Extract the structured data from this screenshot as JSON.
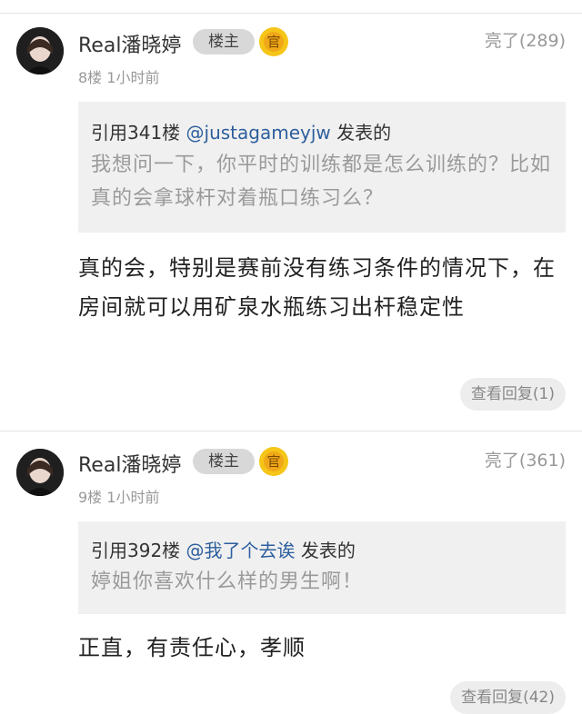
{
  "posts": [
    {
      "username": "Real潘晓婷",
      "badge_host": "楼主",
      "badge_official": "官",
      "likes": "亮了(289)",
      "floor_time": "8楼 1小时前",
      "quote": {
        "prefix": "引用341楼 ",
        "user": "@justagameyjw",
        "suffix": " 发表的",
        "text": "我想问一下，你平时的训练都是怎么训练的？比如真的会拿球杆对着瓶口练习么？"
      },
      "reply": "真的会，特别是赛前没有练习条件的情况下，在房间就可以用矿泉水瓶练习出杆稳定性",
      "view_replies": "查看回复(1)"
    },
    {
      "username": "Real潘晓婷",
      "badge_host": "楼主",
      "badge_official": "官",
      "likes": "亮了(361)",
      "floor_time": "9楼 1小时前",
      "quote": {
        "prefix": "引用392楼 ",
        "user": "@我了个去诶",
        "suffix": " 发表的",
        "text": "婷姐你喜欢什么样的男生啊！"
      },
      "reply": "正直，有责任心，孝顺",
      "view_replies": "查看回复(42)"
    }
  ],
  "colors": {
    "link": "#2d5f9e",
    "badge_official": "#f5c518",
    "quote_bg": "#f0f0f0"
  }
}
